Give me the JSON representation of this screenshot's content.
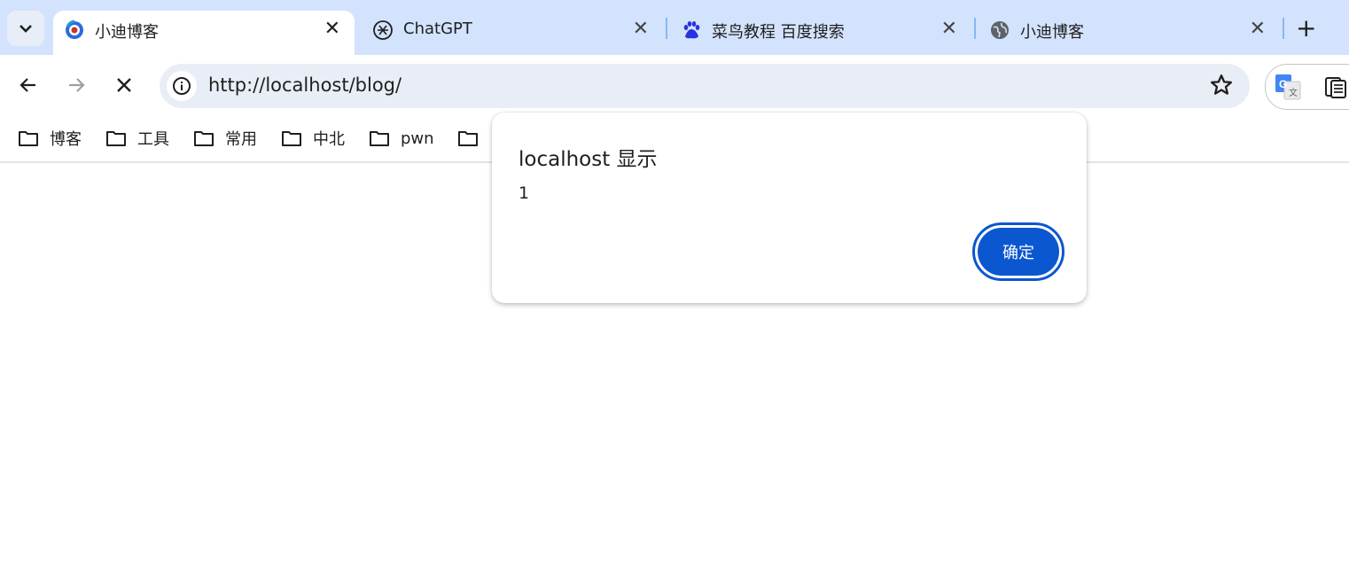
{
  "tabs": [
    {
      "title": "小迪博客",
      "favicon": "site-icon",
      "active": true
    },
    {
      "title": "ChatGPT",
      "favicon": "chatgpt-icon",
      "active": false
    },
    {
      "title": "菜鸟教程 百度搜索",
      "favicon": "baidu-icon",
      "active": false
    },
    {
      "title": "小迪博客",
      "favicon": "globe-icon",
      "active": false
    }
  ],
  "toolbar": {
    "url": "http://localhost/blog/"
  },
  "bookmarks": [
    "博客",
    "工具",
    "常用",
    "中北",
    "pwn"
  ],
  "dialog": {
    "title": "localhost 显示",
    "message": "1",
    "ok_label": "确定"
  },
  "colors": {
    "tabstrip": "#d3e3fd",
    "omnibox": "#e9eef6",
    "accent": "#0b57d0"
  }
}
